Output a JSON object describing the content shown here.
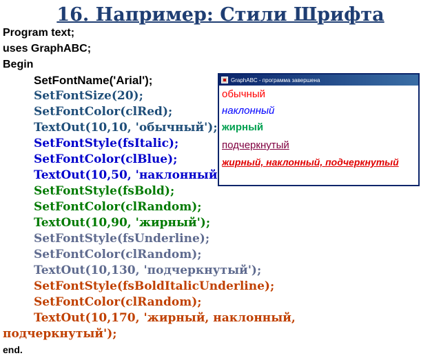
{
  "slide_title": "16. Например: Стили Шрифта",
  "code_lines": [
    "Program text;",
    "uses GraphABC;",
    "Begin",
    "SetFontName('Arial');",
    "SetFontSize(20);",
    "SetFontColor(clRed);",
    "TextOut(10,10, 'обычный');",
    "SetFontStyle(fsItalic);",
    "SetFontColor(clBlue);",
    "TextOut(10,50, 'наклонный');",
    "SetFontStyle(fsBold);",
    "SetFontColor(clRandom);",
    "TextOut(10,90, 'жирный');",
    "SetFontStyle(fsUnderline);",
    "SetFontColor(clRandom);",
    "TextOut(10,130, 'подчеркнутый');",
    "SetFontStyle(fsBoldItalicUnderline);",
    "SetFontColor(clRandom);",
    "TextOut(10,170, 'жирный, наклонный,",
    "подчеркнутый');",
    "end."
  ],
  "window": {
    "title": "GraphABC - программа завершена",
    "outputs": [
      "обычный",
      "наклонный",
      "жирный",
      "подчеркнутый",
      "жирный, наклонный, подчеркнутый"
    ]
  },
  "colors": {
    "title": "#1f3e73",
    "code_blue": "#1f4e79",
    "code_darkblue": "#0000cc",
    "code_green": "#007a00",
    "code_gray": "#5f6b8f",
    "code_orange": "#c04000",
    "out_red": "#ff0000",
    "out_blue": "#0000ff",
    "out_green": "#00a050",
    "out_purple": "#800040",
    "out_red2": "#e00000"
  }
}
